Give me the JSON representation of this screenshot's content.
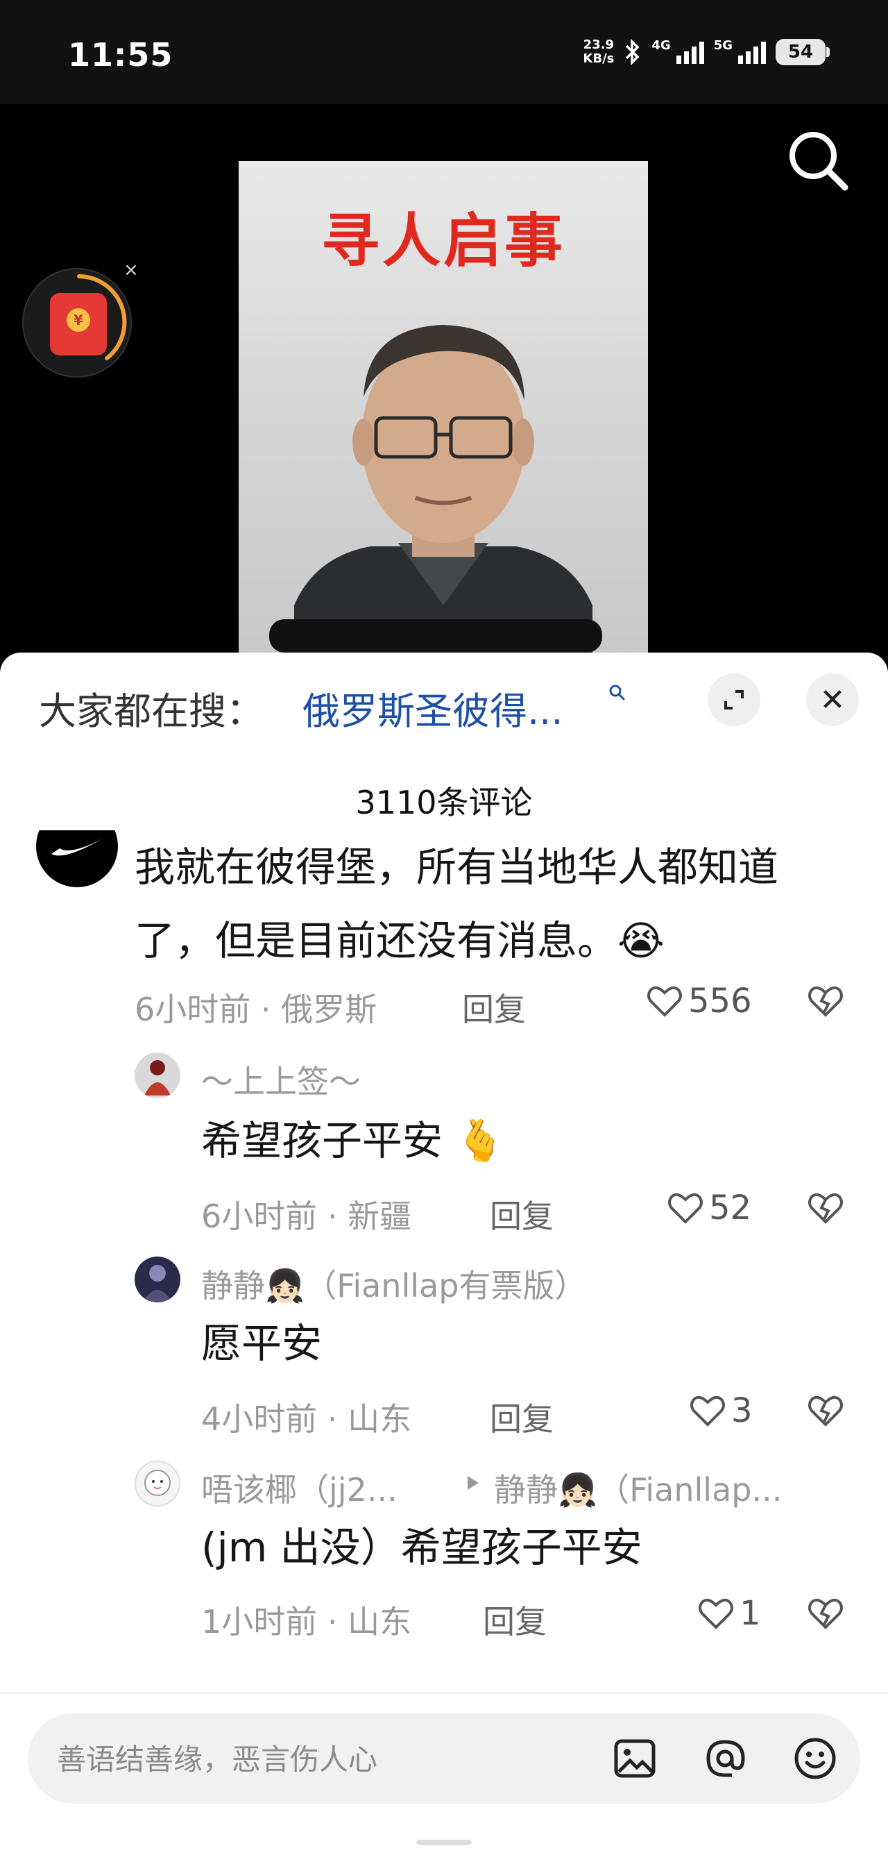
{
  "status_bar": {
    "time": "11:55",
    "net_speed_value": "23.9",
    "net_speed_unit": "KB/s",
    "sim1_label": "4G",
    "sim2_label": "5G",
    "battery": "54"
  },
  "video": {
    "poster_title": "寻人启事",
    "redpacket_coin": "¥",
    "redpacket_close": "×"
  },
  "sheet": {
    "trend_label": "大家都在搜：",
    "trend_query": "俄罗斯圣彼得...",
    "close_glyph": "✕",
    "comment_count": "3110条评论"
  },
  "comments": [
    {
      "username": "",
      "content": "我就在彼得堡，所有当地华人都知道了，但是目前还没有消息。😭",
      "time": "6小时前",
      "location": "俄罗斯",
      "reply_label": "回复",
      "likes": "556"
    },
    {
      "username": "～上上签～",
      "content": "希望孩子平安 🫰",
      "time": "6小时前",
      "location": "新疆",
      "reply_label": "回复",
      "likes": "52"
    },
    {
      "username": "静静👧🏻（Fianllap有票版）",
      "content": "愿平安",
      "time": "4小时前",
      "location": "山东",
      "reply_label": "回复",
      "likes": "3"
    },
    {
      "username": "唔该椰（jj2...",
      "reply_to": "静静👧🏻（Fianllap...",
      "content": "(jm 出没）希望孩子平安",
      "time": "1小时前",
      "location": "山东",
      "reply_label": "回复",
      "likes": "1"
    }
  ],
  "input": {
    "placeholder": "善语结善缘，恶言伤人心"
  },
  "icons": {
    "search": "search-icon",
    "expand": "expand-icon",
    "close": "close-icon",
    "heart": "heart-icon",
    "dislike": "broken-heart-icon",
    "image": "image-icon",
    "mention": "at-icon",
    "emoji": "emoji-icon"
  },
  "colors": {
    "accent_link": "#1d4fa8",
    "poster_title": "#e0281e",
    "redpacket": "#e53935"
  }
}
